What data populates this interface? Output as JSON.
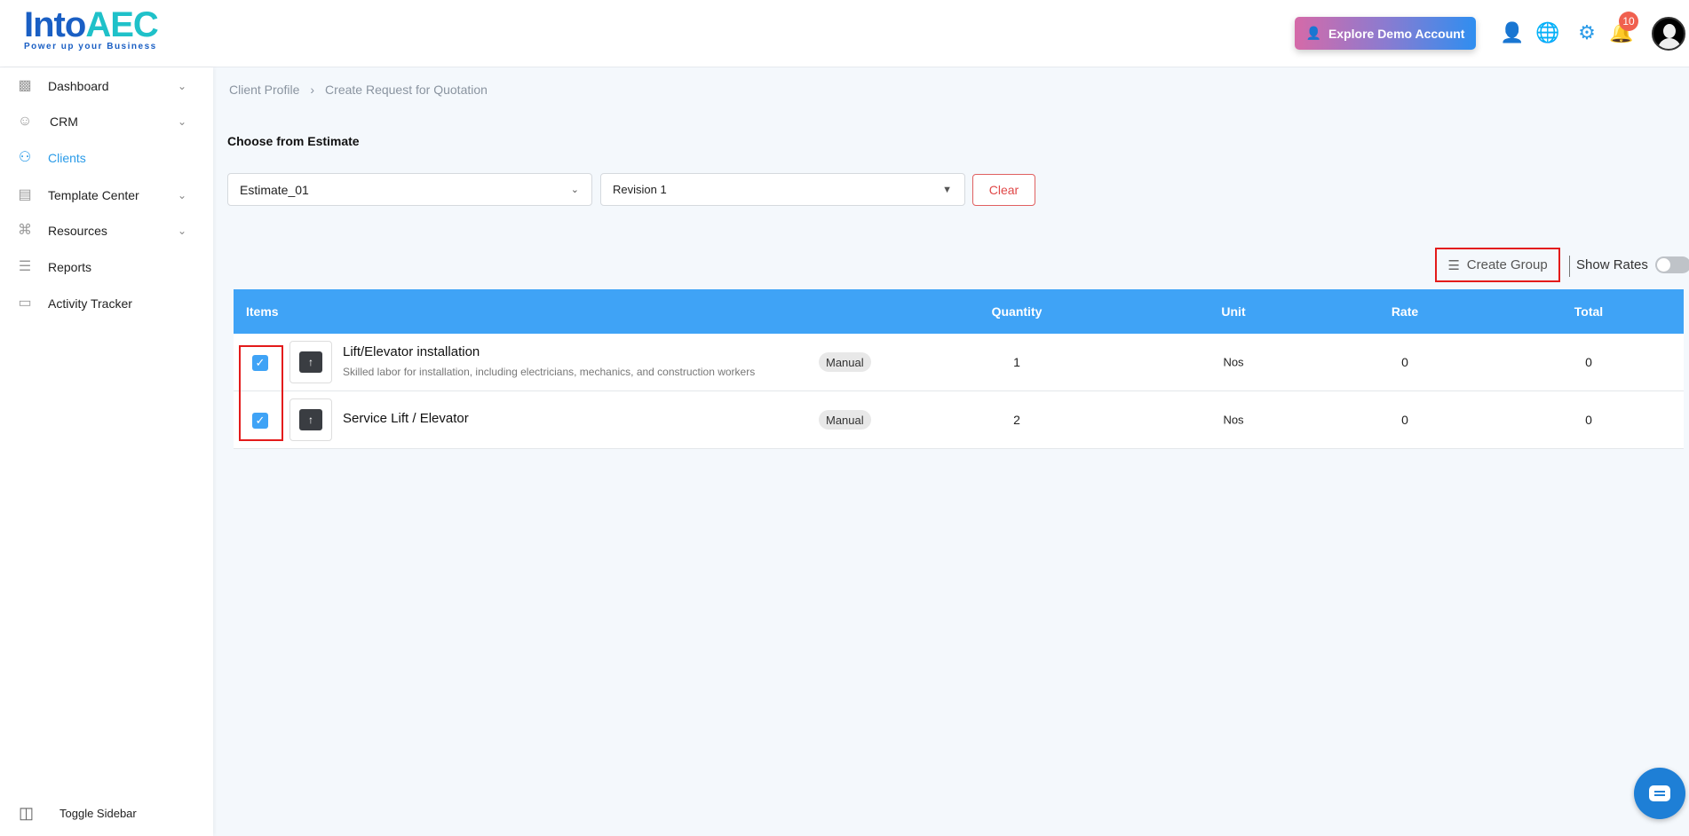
{
  "header": {
    "logo_text": "IntoAEC",
    "logo_tagline": "Power up your Business",
    "demo_button": "Explore Demo Account",
    "notification_count": "10"
  },
  "sidebar": {
    "items": [
      {
        "label": "Dashboard"
      },
      {
        "label": "CRM"
      },
      {
        "label": "Clients"
      },
      {
        "label": "Template Center"
      },
      {
        "label": "Resources"
      },
      {
        "label": "Reports"
      },
      {
        "label": "Activity Tracker"
      }
    ],
    "toggle": "Toggle Sidebar"
  },
  "breadcrumb": [
    "Client Profile",
    "Create Request for Quotation"
  ],
  "section_title": "Choose from Estimate",
  "estimate_select": "Estimate_01",
  "revision_select": "Revision 1",
  "clear_label": "Clear",
  "create_group": "Create Group",
  "show_rates": "Show Rates",
  "show_rates_on": false,
  "table": {
    "headers": [
      "Items",
      "Quantity",
      "Unit",
      "Rate",
      "Total"
    ],
    "rows": [
      {
        "name": "Lift/Elevator installation",
        "description": "Skilled labor for installation, including electricians, mechanics, and construction workers",
        "tag": "Manual",
        "quantity": "1",
        "unit": "Nos",
        "rate": "0",
        "total": "0",
        "checked": true
      },
      {
        "name": "Service Lift / Elevator",
        "tag": "Manual",
        "quantity": "2",
        "unit": "Nos",
        "rate": "0",
        "total": "0",
        "checked": true
      }
    ]
  },
  "colors": {
    "accent": "#3fa3f6",
    "highlight": "#e31b1b"
  }
}
